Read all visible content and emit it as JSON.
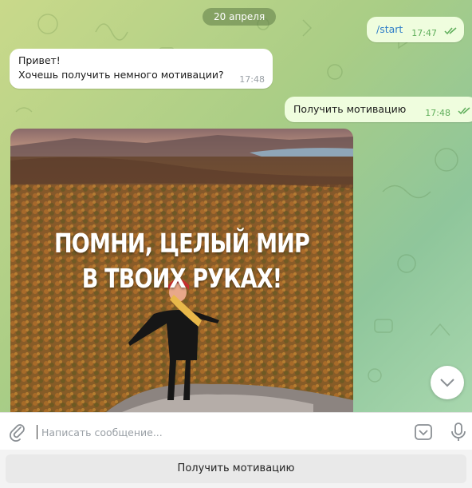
{
  "chat": {
    "date_separator": "20 апреля",
    "messages": [
      {
        "direction": "out",
        "text": "/start",
        "time": "17:47",
        "status": "read"
      },
      {
        "direction": "in",
        "text_line1": "Привет!",
        "text_line2": "Хочешь получить немного мотивации?",
        "time": "17:48"
      },
      {
        "direction": "out",
        "text": "Получить мотивацию",
        "time": "17:48",
        "status": "read"
      },
      {
        "direction": "in",
        "type": "photo",
        "caption_line1": "ПОМНИ, ЦЕЛЫЙ МИР",
        "caption_line2": "В ТВОИХ РУКАХ!"
      }
    ]
  },
  "composer": {
    "placeholder": "Написать сообщение...",
    "value": ""
  },
  "reply_keyboard": {
    "buttons": [
      "Получить мотивацию"
    ]
  },
  "icons": {
    "attach": "paperclip-icon",
    "keyboard": "bot-keyboard-icon",
    "mic": "microphone-icon",
    "scroll": "chevron-down-icon",
    "read_status": "double-check-icon"
  },
  "colors": {
    "outgoing_bubble": "#effdde",
    "incoming_bubble": "#ffffff",
    "link": "#2f7ec8",
    "read_check": "#5fae5b"
  }
}
